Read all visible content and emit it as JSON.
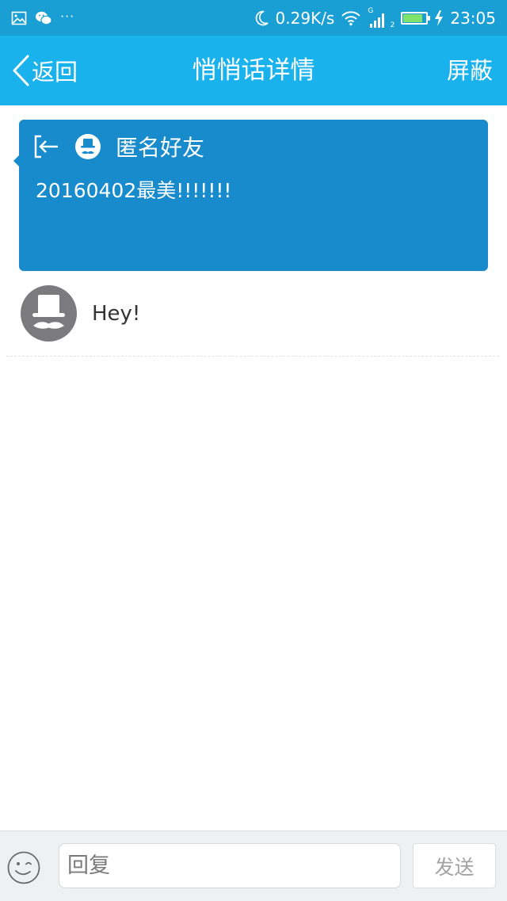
{
  "status_bar": {
    "network_speed": "0.29K/s",
    "network_type": "G",
    "sim_slot": "2",
    "time": "23:05",
    "more_indicator": "···",
    "battery_level": 0.85,
    "icons": [
      "image-icon",
      "wechat-icon",
      "more-icon",
      "moon-icon",
      "wifi-icon",
      "signal-icon",
      "battery-icon",
      "charging-icon"
    ]
  },
  "nav": {
    "back_label": "返回",
    "title": "悄悄话详情",
    "action_label": "屏蔽"
  },
  "message": {
    "sender": "匿名好友",
    "content": "20160402最美!!!!!!!",
    "card_color": "#188bcd"
  },
  "reply": {
    "text": "Hey!"
  },
  "input_bar": {
    "placeholder": "回复",
    "value": "",
    "send_label": "发送"
  },
  "colors": {
    "status_bar": "#1a9fd4",
    "nav_bar": "#1ab2ec",
    "card": "#188bcd",
    "avatar": "#7b7b7d"
  }
}
